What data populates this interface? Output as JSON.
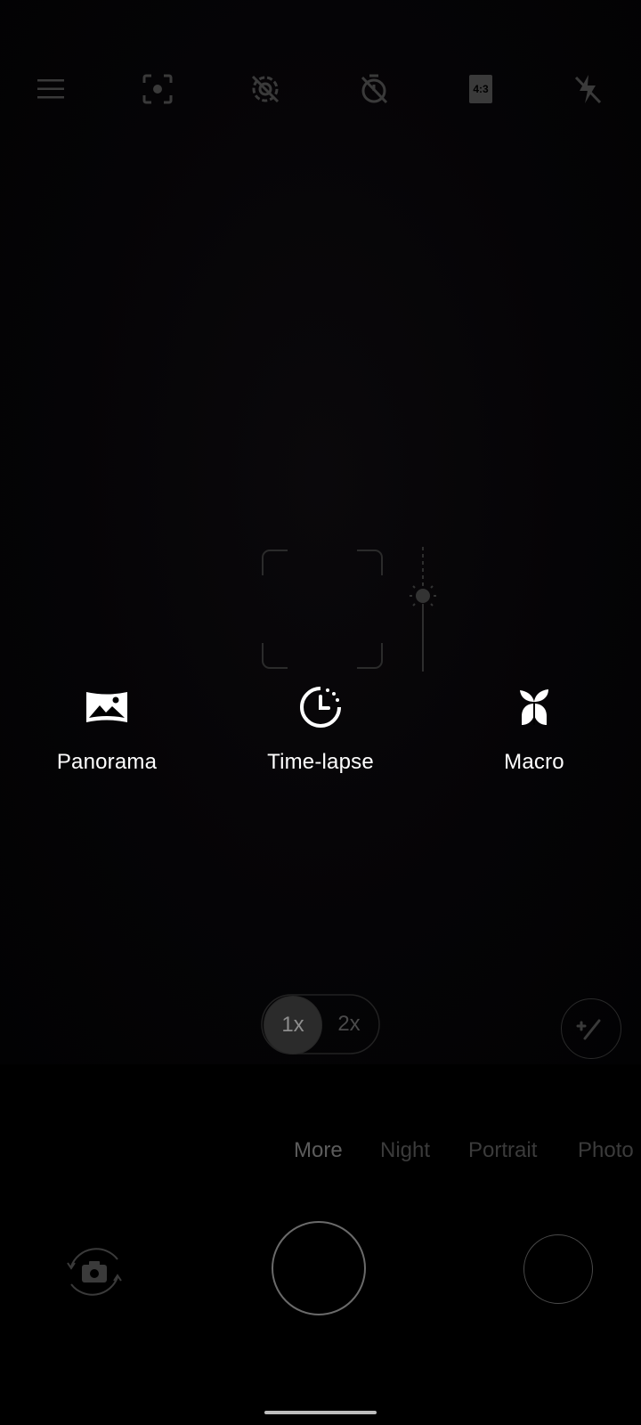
{
  "top_bar": {
    "icons": [
      "menu-icon",
      "focus-icon",
      "motion-photo-off-icon",
      "timer-off-icon",
      "aspect-ratio-icon",
      "flash-off-icon"
    ],
    "aspect_ratio_label": "4:3"
  },
  "more_modes": [
    {
      "label": "Panorama",
      "icon": "panorama-icon"
    },
    {
      "label": "Time-lapse",
      "icon": "time-lapse-icon"
    },
    {
      "label": "Macro",
      "icon": "macro-icon"
    }
  ],
  "zoom": {
    "options": [
      "1x",
      "2x"
    ],
    "selected": "1x"
  },
  "mode_strip": {
    "tabs": [
      "More",
      "Night",
      "Portrait",
      "Photo"
    ],
    "selected": "More"
  },
  "colors": {
    "background": "#000000",
    "inactive_icon": "#3a3a3a",
    "text_active": "#ffffff"
  }
}
